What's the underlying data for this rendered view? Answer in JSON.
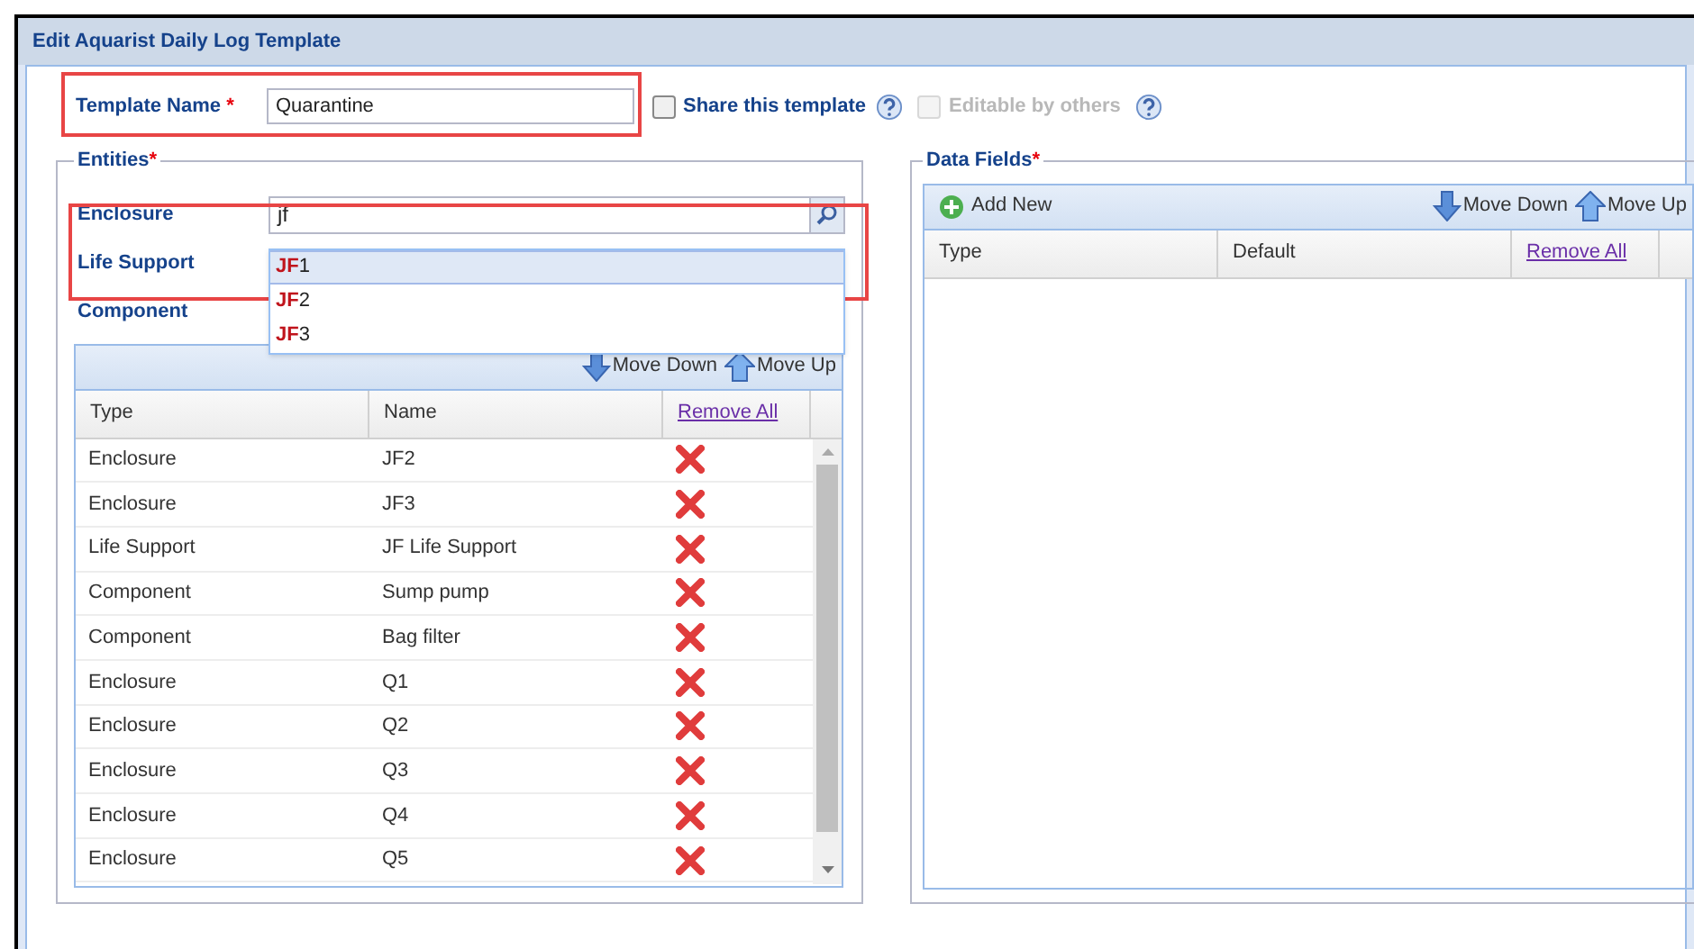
{
  "window": {
    "title": "Edit Aquarist Daily Log Template"
  },
  "template_name": {
    "label": "Template Name",
    "required_mark": "*",
    "value": "Quarantine"
  },
  "share": {
    "label": "Share this template",
    "checked": false,
    "disabled": false
  },
  "editable": {
    "label": "Editable by others",
    "checked": false,
    "disabled": true
  },
  "entities": {
    "legend": "Entities",
    "required_mark": "*",
    "lookups": [
      {
        "label": "Enclosure",
        "value": "jf"
      },
      {
        "label": "Life Support"
      },
      {
        "label": "Component"
      }
    ],
    "suggestions": [
      {
        "text": "**JF**1",
        "selected": true
      },
      {
        "text": "**JF**2",
        "selected": false
      },
      {
        "text": "**JF**3",
        "selected": false
      }
    ],
    "toolbar": [
      "Move Down",
      "Move Up"
    ],
    "columns": [
      "Type",
      "Name",
      "Remove All"
    ],
    "rows": [
      {
        "type": "Enclosure",
        "name": "JF2"
      },
      {
        "type": "Enclosure",
        "name": "JF3"
      },
      {
        "type": "Life Support",
        "name": "JF Life Support"
      },
      {
        "type": "Component",
        "name": "Sump pump"
      },
      {
        "type": "Component",
        "name": "Bag filter"
      },
      {
        "type": "Enclosure",
        "name": "Q1"
      },
      {
        "type": "Enclosure",
        "name": "Q2"
      },
      {
        "type": "Enclosure",
        "name": "Q3"
      },
      {
        "type": "Enclosure",
        "name": "Q4"
      },
      {
        "type": "Enclosure",
        "name": "Q5"
      }
    ]
  },
  "data_fields": {
    "legend": "Data Fields",
    "required_mark": "*",
    "add_button": "Add New",
    "toolbar": [
      "Move Down",
      "Move Up"
    ],
    "columns": [
      "Type",
      "Default",
      "Remove All"
    ]
  }
}
